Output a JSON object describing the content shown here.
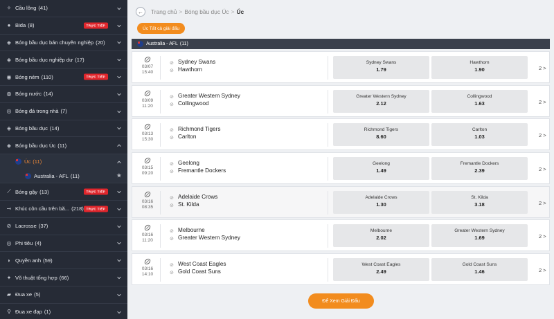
{
  "sidebar": {
    "items": [
      {
        "label": "Cầu lông",
        "count": "(41)",
        "icon": "shuttlecock-icon",
        "live": false
      },
      {
        "label": "Bida",
        "count": "(8)",
        "icon": "billiards-icon",
        "live": true
      },
      {
        "label": "Bóng bầu dục bán chuyên nghiệp",
        "count": "(20)",
        "icon": "rugby-ball-icon",
        "live": false
      },
      {
        "label": "Bóng bầu dục nghiệp dư",
        "count": "(17)",
        "icon": "rugby-ball-icon",
        "live": false
      },
      {
        "label": "Bóng ném",
        "count": "(110)",
        "icon": "handball-icon",
        "live": true
      },
      {
        "label": "Bóng nước",
        "count": "(14)",
        "icon": "water-polo-icon",
        "live": false
      },
      {
        "label": "Bóng đá trong nhà",
        "count": "(7)",
        "icon": "futsal-icon",
        "live": false
      },
      {
        "label": "Bóng bầu dục",
        "count": "(14)",
        "icon": "rugby-ball-icon",
        "live": false
      },
      {
        "label": "Bóng bầu dục Úc",
        "count": "(11)",
        "icon": "aussie-rules-icon",
        "live": false,
        "expanded": true
      }
    ],
    "sub_country": {
      "label": "Úc",
      "count": "(11)"
    },
    "sub_league": {
      "label": "Australia - AFL",
      "count": "(11)"
    },
    "items_after": [
      {
        "label": "Bóng gậy",
        "count": "(13)",
        "icon": "cricket-icon",
        "live": true
      },
      {
        "label": "Khúc côn cầu trên bă...",
        "count": "(218)",
        "icon": "ice-hockey-icon",
        "live": true
      },
      {
        "label": "Lacrosse",
        "count": "(37)",
        "icon": "lacrosse-icon",
        "live": false
      },
      {
        "label": "Phi tiêu",
        "count": "(4)",
        "icon": "darts-icon",
        "live": false
      },
      {
        "label": "Quyền anh",
        "count": "(59)",
        "icon": "boxing-glove-icon",
        "live": false
      },
      {
        "label": "Võ thuật tổng hợp",
        "count": "(66)",
        "icon": "mma-icon",
        "live": false
      },
      {
        "label": "Đua xe",
        "count": "(5)",
        "icon": "racing-car-icon",
        "live": false
      },
      {
        "label": "Đua xe đạp",
        "count": "(1)",
        "icon": "bicycle-icon",
        "live": false
      }
    ],
    "live_badge": "TRỰC TIẾP"
  },
  "breadcrumb": {
    "home": "Trang chủ",
    "sport": "Bóng bầu dục Úc",
    "current": "Úc"
  },
  "all_button": "Úc Tất cả giải đấu",
  "league": {
    "name": "Australia - AFL",
    "count": "(11)"
  },
  "matches": [
    {
      "date": "03/07",
      "time": "15:40",
      "home": "Sydney Swans",
      "away": "Hawthorn",
      "home_odd": "1.79",
      "away_odd": "1.90",
      "more": "2 >"
    },
    {
      "date": "03/09",
      "time": "11:20",
      "home": "Greater Western Sydney",
      "away": "Collingwood",
      "home_odd": "2.12",
      "away_odd": "1.63",
      "more": "2 >"
    },
    {
      "date": "03/13",
      "time": "15:30",
      "home": "Richmond Tigers",
      "away": "Carlton",
      "home_odd": "8.60",
      "away_odd": "1.03",
      "more": "2 >"
    },
    {
      "date": "03/15",
      "time": "09:20",
      "home": "Geelong",
      "away": "Fremantle Dockers",
      "home_odd": "1.49",
      "away_odd": "2.39",
      "more": "2 >"
    },
    {
      "date": "03/16",
      "time": "08:35",
      "home": "Adelaide Crows",
      "away": "St. Kilda",
      "home_odd": "1.30",
      "away_odd": "3.18",
      "more": "2 >"
    },
    {
      "date": "03/16",
      "time": "11:20",
      "home": "Melbourne",
      "away": "Greater Western Sydney",
      "home_odd": "2.02",
      "away_odd": "1.69",
      "more": "2 >"
    },
    {
      "date": "03/16",
      "time": "14:10",
      "home": "West Coast Eagles",
      "away": "Gold Coast Suns",
      "home_odd": "2.49",
      "away_odd": "1.46",
      "more": "2 >"
    }
  ],
  "view_button": "Để Xem Giải Đấu",
  "colors": {
    "accent": "#f28c1e",
    "sidebar_bg": "#262b36",
    "live": "#e0262c"
  }
}
